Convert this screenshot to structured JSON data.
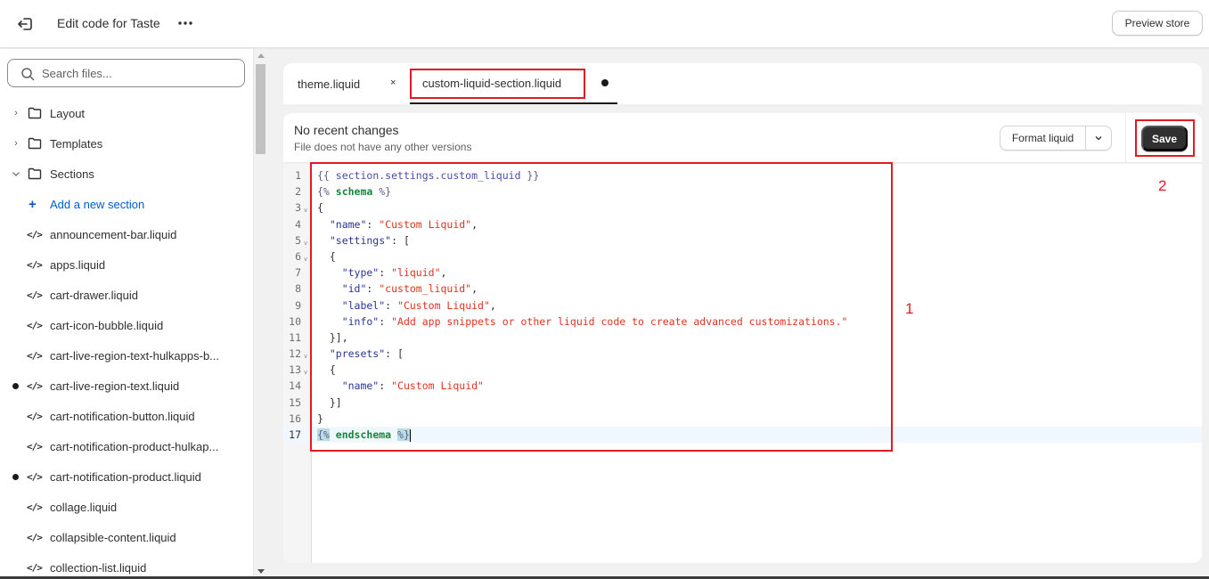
{
  "topbar": {
    "exit_icon": "exit-icon",
    "title": "Edit code for Taste",
    "more_icon": "more-horizontal-icon",
    "preview_label": "Preview store"
  },
  "sidebar": {
    "search_placeholder": "Search files...",
    "folders": [
      {
        "label": "Layout",
        "expanded": false
      },
      {
        "label": "Templates",
        "expanded": false
      },
      {
        "label": "Sections",
        "expanded": true
      }
    ],
    "add_section_label": "Add a new section",
    "files": [
      {
        "label": "announcement-bar.liquid",
        "modified": false
      },
      {
        "label": "apps.liquid",
        "modified": false
      },
      {
        "label": "cart-drawer.liquid",
        "modified": false
      },
      {
        "label": "cart-icon-bubble.liquid",
        "modified": false
      },
      {
        "label": "cart-live-region-text-hulkapps-b...",
        "modified": false
      },
      {
        "label": "cart-live-region-text.liquid",
        "modified": true
      },
      {
        "label": "cart-notification-button.liquid",
        "modified": false
      },
      {
        "label": "cart-notification-product-hulkap...",
        "modified": false
      },
      {
        "label": "cart-notification-product.liquid",
        "modified": true
      },
      {
        "label": "collage.liquid",
        "modified": false
      },
      {
        "label": "collapsible-content.liquid",
        "modified": false
      },
      {
        "label": "collection-list.liquid",
        "modified": false
      }
    ]
  },
  "tabs": [
    {
      "label": "theme.liquid",
      "close": "×",
      "active": false
    },
    {
      "label": "custom-liquid-section.liquid",
      "active": true,
      "unsaved": true
    }
  ],
  "infobar": {
    "title": "No recent changes",
    "subtitle": "File does not have any other versions",
    "format_label": "Format liquid",
    "save_label": "Save"
  },
  "editor": {
    "active_line": 17,
    "lines": [
      {
        "n": "1",
        "fold": false
      },
      {
        "n": "2",
        "fold": false
      },
      {
        "n": "3",
        "fold": true
      },
      {
        "n": "4",
        "fold": false
      },
      {
        "n": "5",
        "fold": true
      },
      {
        "n": "6",
        "fold": true
      },
      {
        "n": "7",
        "fold": false
      },
      {
        "n": "8",
        "fold": false
      },
      {
        "n": "9",
        "fold": false
      },
      {
        "n": "10",
        "fold": false
      },
      {
        "n": "11",
        "fold": false
      },
      {
        "n": "12",
        "fold": true
      },
      {
        "n": "13",
        "fold": true
      },
      {
        "n": "14",
        "fold": false
      },
      {
        "n": "15",
        "fold": false
      },
      {
        "n": "16",
        "fold": false
      },
      {
        "n": "17",
        "fold": false
      }
    ],
    "code": {
      "l1_open": "{{",
      "l1_var": " section.settings.custom_liquid ",
      "l1_close": "}}",
      "l2_open": "{%",
      "l2_tag": " schema ",
      "l2_close": "%}",
      "l3": "{",
      "l4_key": "  \"name\"",
      "l4_sep": ": ",
      "l4_val": "\"Custom Liquid\"",
      "l4_end": ",",
      "l5_key": "  \"settings\"",
      "l5_end": ": [",
      "l6": "  {",
      "l7_key": "    \"type\"",
      "l7_sep": ": ",
      "l7_val": "\"liquid\"",
      "l7_end": ",",
      "l8_key": "    \"id\"",
      "l8_sep": ": ",
      "l8_val": "\"custom_liquid\"",
      "l8_end": ",",
      "l9_key": "    \"label\"",
      "l9_sep": ": ",
      "l9_val": "\"Custom Liquid\"",
      "l9_end": ",",
      "l10_key": "    \"info\"",
      "l10_sep": ": ",
      "l10_val": "\"Add app snippets or other liquid code to create advanced customizations.\"",
      "l11": "  }],",
      "l12_key": "  \"presets\"",
      "l12_end": ": [",
      "l13": "  {",
      "l14_key": "    \"name\"",
      "l14_sep": ": ",
      "l14_val": "\"Custom Liquid\"",
      "l15": "  }]",
      "l16": "}",
      "l17_open": "{%",
      "l17_tag": " endschema ",
      "l17_close": "%}"
    }
  },
  "annotations": {
    "code_box_number": "1",
    "save_box_number": "2",
    "color": "#e21b23"
  }
}
